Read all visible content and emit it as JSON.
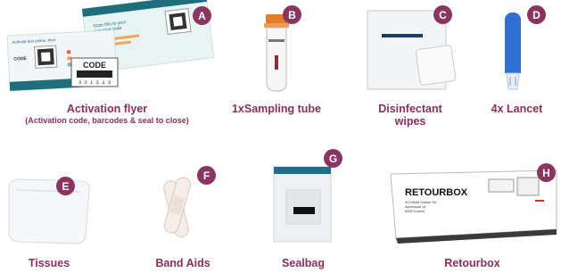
{
  "colors": {
    "accent": "#8a3560",
    "label": "#8a2f5b",
    "teal": "#1f6e7c"
  },
  "items": [
    {
      "letter": "A",
      "label": "Activation  flyer",
      "sublabel": "(Activation code, barcodes & seal to close)",
      "icon": "activation-flyer-icon"
    },
    {
      "letter": "B",
      "label": "1xSampling tube",
      "icon": "sampling-tube-icon"
    },
    {
      "letter": "C",
      "label": "Disinfectant wipes",
      "icon": "disinfectant-wipes-icon"
    },
    {
      "letter": "D",
      "label": "4x Lancet",
      "icon": "lancet-icon"
    },
    {
      "letter": "E",
      "label": "Tissues",
      "icon": "tissues-icon"
    },
    {
      "letter": "F",
      "label": "Band Aids",
      "icon": "band-aids-icon"
    },
    {
      "letter": "G",
      "label": "Sealbag",
      "icon": "sealbag-icon"
    },
    {
      "letter": "H",
      "label": "Retourbox",
      "icon": "retourbox-icon"
    }
  ],
  "flyer": {
    "headline": "Activate test online, then ",
    "code_label": "CODE",
    "code_number": "3 2 1 2 1 3",
    "small_code": "CODE"
  },
  "retourbox": {
    "title": "RETOURBOX",
    "address": [
      "31745A8 Suisse SA",
      "Alpenquai 14",
      "6002 Luzern"
    ]
  }
}
